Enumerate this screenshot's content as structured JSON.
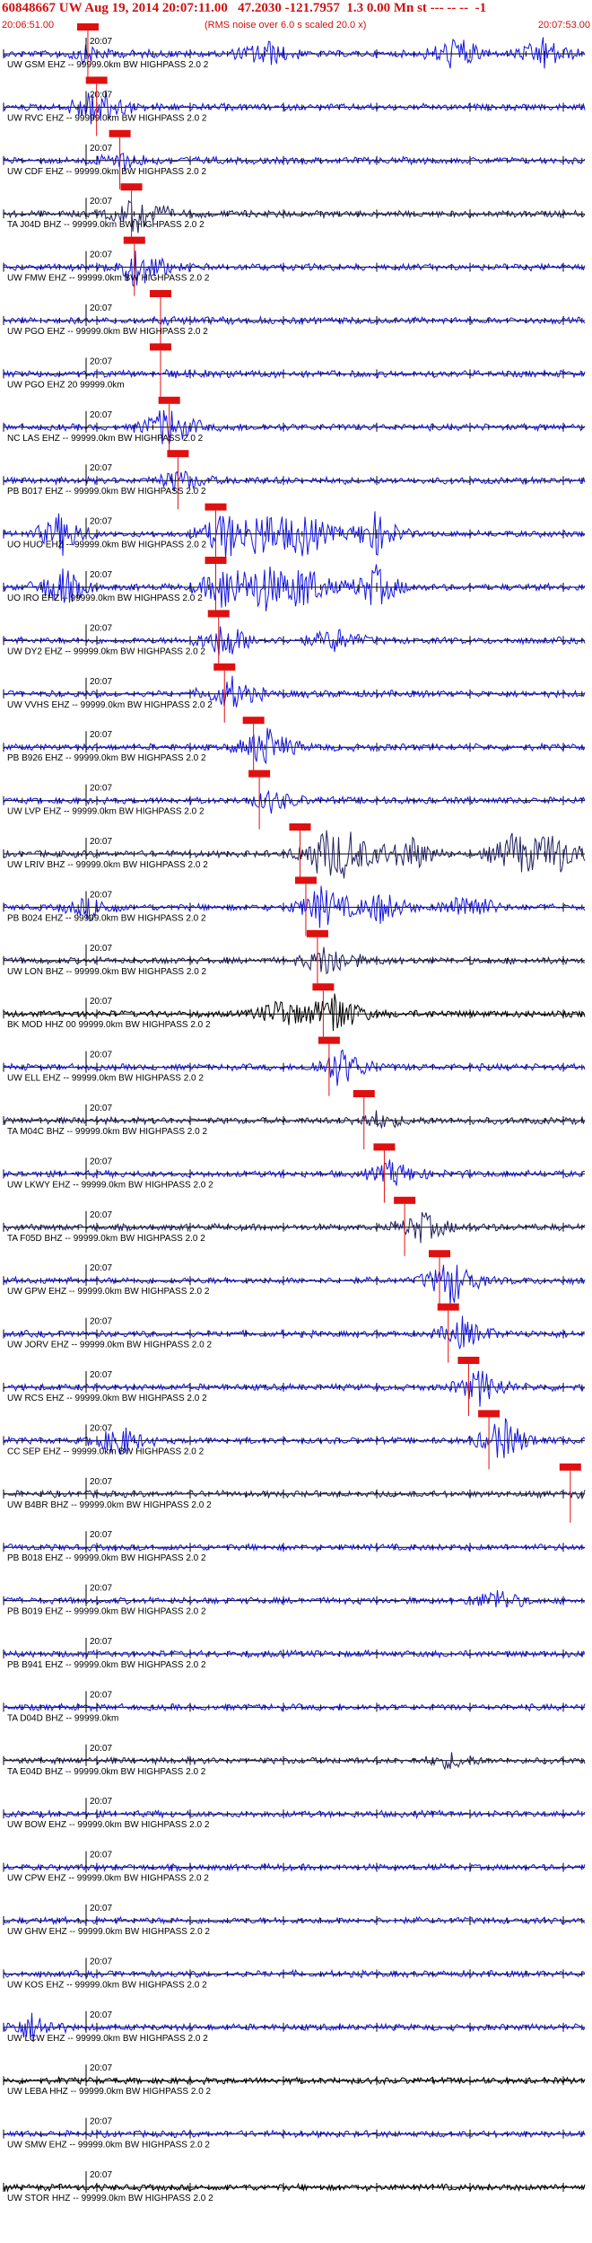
{
  "header": {
    "title": "60848667 UW Aug 19, 2014 20:07:11.00   47.2030 -121.7957  1.3 0.00 Mn st --- -- --  -1",
    "start_time": "20:06:51.00",
    "note": "(RMS noise over 6.0 s scaled 20.0 x)",
    "end_time": "20:07:53.00"
  },
  "colors": {
    "trace_blue": "#1515e0",
    "trace_dark": "#202060",
    "trace_black": "#000000",
    "pick_red": "#e01010",
    "header_red": "#d01010"
  },
  "minute_label": "20:07",
  "traces": [
    {
      "label": "UW GSM EHZ -- 99999.0km BW  HIGHPASS  2.0  2",
      "color": "trace_blue",
      "pick": 0.145,
      "events": [
        [
          0.14,
          0.3
        ],
        [
          0.45,
          0.6
        ],
        [
          0.78,
          0.8
        ],
        [
          0.93,
          0.7
        ]
      ]
    },
    {
      "label": "UW RVC EHZ -- 99999.0km BW  HIGHPASS  2.0  2",
      "color": "trace_blue",
      "pick": 0.16,
      "events": [
        [
          0.16,
          1.0
        ]
      ]
    },
    {
      "label": "UW CDF EHZ -- 99999.0km BW  HIGHPASS  2.0  2",
      "color": "trace_blue",
      "pick": 0.2,
      "events": [
        [
          0.2,
          0.35
        ]
      ]
    },
    {
      "label": "TA J04D BHZ -- 99999.0km BW  HIGHPASS  2.0  2",
      "color": "trace_dark",
      "pick": 0.22,
      "events": [
        [
          0.23,
          0.8
        ]
      ]
    },
    {
      "label": "UW FMW EHZ -- 99999.0km BW  HIGHPASS  2.0  2",
      "color": "trace_blue",
      "pick": 0.225,
      "events": [
        [
          0.23,
          0.9
        ]
      ]
    },
    {
      "label": "UW PGO EHZ -- 99999.0km BW  HIGHPASS  2.0  2",
      "color": "trace_blue",
      "pick": 0.27,
      "events": []
    },
    {
      "label": "UW PGO EHZ 20 99999.0km",
      "color": "trace_blue",
      "pick": 0.27,
      "events": []
    },
    {
      "label": "NC LAS EHZ -- 99999.0km BW  HIGHPASS  2.0  2",
      "color": "trace_blue",
      "pick": 0.285,
      "events": [
        [
          0.28,
          0.9
        ]
      ]
    },
    {
      "label": "PB B017 EHZ -- 99999.0km BW  HIGHPASS  2.0  2",
      "color": "trace_blue",
      "pick": 0.3,
      "events": [
        [
          0.3,
          0.45
        ]
      ]
    },
    {
      "label": "UO HUO EHZ -- 99999.0km BW  HIGHPASS  2.0  2",
      "color": "trace_blue",
      "pick": 0.365,
      "events": [
        [
          0.1,
          0.9
        ],
        [
          0.38,
          1.0
        ],
        [
          0.45,
          1.0
        ],
        [
          0.52,
          1.0
        ],
        [
          0.64,
          0.9
        ]
      ]
    },
    {
      "label": "UO IRO EHZ -- 99999.0km BW  HIGHPASS  2.0  2",
      "color": "trace_blue",
      "pick": 0.365,
      "events": [
        [
          0.1,
          0.9
        ],
        [
          0.38,
          1.0
        ],
        [
          0.45,
          1.0
        ],
        [
          0.52,
          1.0
        ],
        [
          0.64,
          0.9
        ]
      ]
    },
    {
      "label": "UW DY2 EHZ -- 99999.0km BW  HIGHPASS  2.0  2",
      "color": "trace_blue",
      "pick": 0.37,
      "events": [
        [
          0.38,
          0.8
        ],
        [
          0.57,
          0.5
        ]
      ]
    },
    {
      "label": "UW VVHS EHZ -- 99999.0km BW  HIGHPASS  2.0  2",
      "color": "trace_blue",
      "pick": 0.38,
      "events": [
        [
          0.39,
          0.7
        ]
      ]
    },
    {
      "label": "PB B926 EHZ -- 99999.0km BW  HIGHPASS  2.0  2",
      "color": "trace_blue",
      "pick": 0.43,
      "events": [
        [
          0.45,
          0.9
        ]
      ]
    },
    {
      "label": "UW LVP EHZ -- 99999.0km BW  HIGHPASS  2.0  2",
      "color": "trace_blue",
      "pick": 0.44,
      "events": [
        [
          0.46,
          0.4
        ]
      ]
    },
    {
      "label": "UW LRIV BHZ -- 99999.0km BW  HIGHPASS  2.0  2",
      "color": "trace_dark",
      "pick": 0.51,
      "events": [
        [
          0.55,
          1.0
        ],
        [
          0.6,
          1.0
        ],
        [
          0.7,
          0.8
        ],
        [
          0.88,
          1.0
        ],
        [
          0.95,
          1.0
        ]
      ]
    },
    {
      "label": "PB B024 EHZ -- 99999.0km BW  HIGHPASS  2.0  2",
      "color": "trace_blue",
      "pick": 0.52,
      "events": [
        [
          0.55,
          0.9
        ],
        [
          0.65,
          0.7
        ],
        [
          0.8,
          0.7
        ],
        [
          0.15,
          0.5
        ]
      ]
    },
    {
      "label": "UW LON BHZ -- 99999.0km BW  HIGHPASS  2.0  2",
      "color": "trace_dark",
      "pick": 0.54,
      "events": [
        [
          0.56,
          0.7
        ]
      ]
    },
    {
      "label": "BK MOD HHZ 00 99999.0km BW  HIGHPASS  2.0  2",
      "color": "trace_black",
      "pick": 0.55,
      "events": [
        [
          0.57,
          1.0
        ],
        [
          0.48,
          0.7
        ]
      ]
    },
    {
      "label": "UW ELL EHZ -- 99999.0km BW  HIGHPASS  2.0  2",
      "color": "trace_blue",
      "pick": 0.56,
      "events": [
        [
          0.58,
          0.8
        ]
      ]
    },
    {
      "label": "TA M04C BHZ -- 99999.0km BW  HIGHPASS  2.0  2",
      "color": "trace_dark",
      "pick": 0.62,
      "events": [
        [
          0.64,
          0.3
        ]
      ]
    },
    {
      "label": "UW LKWY EHZ -- 99999.0km BW  HIGHPASS  2.0  2",
      "color": "trace_blue",
      "pick": 0.655,
      "events": [
        [
          0.67,
          0.5
        ]
      ]
    },
    {
      "label": "TA F05D BHZ -- 99999.0km BW  HIGHPASS  2.0  2",
      "color": "trace_dark",
      "pick": 0.69,
      "events": [
        [
          0.72,
          0.6
        ]
      ]
    },
    {
      "label": "UW GPW EHZ -- 99999.0km BW  HIGHPASS  2.0  2",
      "color": "trace_blue",
      "pick": 0.75,
      "events": [
        [
          0.77,
          1.0
        ]
      ]
    },
    {
      "label": "UW JORV EHZ -- 99999.0km BW  HIGHPASS  2.0  2",
      "color": "trace_blue",
      "pick": 0.765,
      "events": [
        [
          0.79,
          0.6
        ]
      ]
    },
    {
      "label": "UW RCS EHZ -- 99999.0km BW  HIGHPASS  2.0  2",
      "color": "trace_blue",
      "pick": 0.8,
      "events": [
        [
          0.82,
          0.7
        ]
      ]
    },
    {
      "label": "CC SEP EHZ -- 99999.0km BW  HIGHPASS  2.0  2",
      "color": "trace_blue",
      "pick": 0.835,
      "events": [
        [
          0.86,
          0.9
        ],
        [
          0.2,
          0.7
        ]
      ]
    },
    {
      "label": "UW B4BR BHZ -- 99999.0km BW  HIGHPASS  2.0  2",
      "color": "trace_dark",
      "pick": 0.975,
      "events": []
    },
    {
      "label": "PB B018 EHZ -- 99999.0km BW  HIGHPASS  2.0  2",
      "color": "trace_blue",
      "pick": null,
      "events": []
    },
    {
      "label": "PB B019 EHZ -- 99999.0km BW  HIGHPASS  2.0  2",
      "color": "trace_blue",
      "pick": null,
      "events": [
        [
          0.85,
          0.5
        ]
      ]
    },
    {
      "label": "PB B941 EHZ -- 99999.0km BW  HIGHPASS  2.0  2",
      "color": "trace_blue",
      "pick": null,
      "events": []
    },
    {
      "label": "TA D04D BHZ -- 99999.0km",
      "color": "trace_blue",
      "pick": null,
      "events": []
    },
    {
      "label": "TA E04D BHZ -- 99999.0km BW  HIGHPASS  2.0  2",
      "color": "trace_dark",
      "pick": null,
      "events": [
        [
          0.77,
          0.3
        ]
      ]
    },
    {
      "label": "UW BOW EHZ -- 99999.0km BW  HIGHPASS  2.0  2",
      "color": "trace_blue",
      "pick": null,
      "events": []
    },
    {
      "label": "UW CPW EHZ -- 99999.0km BW  HIGHPASS  2.0  2",
      "color": "trace_blue",
      "pick": null,
      "events": []
    },
    {
      "label": "UW GHW EHZ -- 99999.0km BW  HIGHPASS  2.0  2",
      "color": "trace_blue",
      "pick": null,
      "events": []
    },
    {
      "label": "UW KOS EHZ -- 99999.0km BW  HIGHPASS  2.0  2",
      "color": "trace_blue",
      "pick": null,
      "events": []
    },
    {
      "label": "UW LCW EHZ -- 99999.0km BW  HIGHPASS  2.0  2",
      "color": "trace_blue",
      "pick": null,
      "events": [
        [
          0.05,
          0.6
        ]
      ]
    },
    {
      "label": "UW LEBA HHZ -- 99999.0km BW  HIGHPASS  2.0  2",
      "color": "trace_black",
      "pick": null,
      "events": []
    },
    {
      "label": "UW SMW EHZ -- 99999.0km BW  HIGHPASS  2.0  2",
      "color": "trace_blue",
      "pick": null,
      "events": []
    },
    {
      "label": "UW STOR HHZ -- 99999.0km BW  HIGHPASS  2.0  2",
      "color": "trace_black",
      "pick": null,
      "events": []
    }
  ]
}
